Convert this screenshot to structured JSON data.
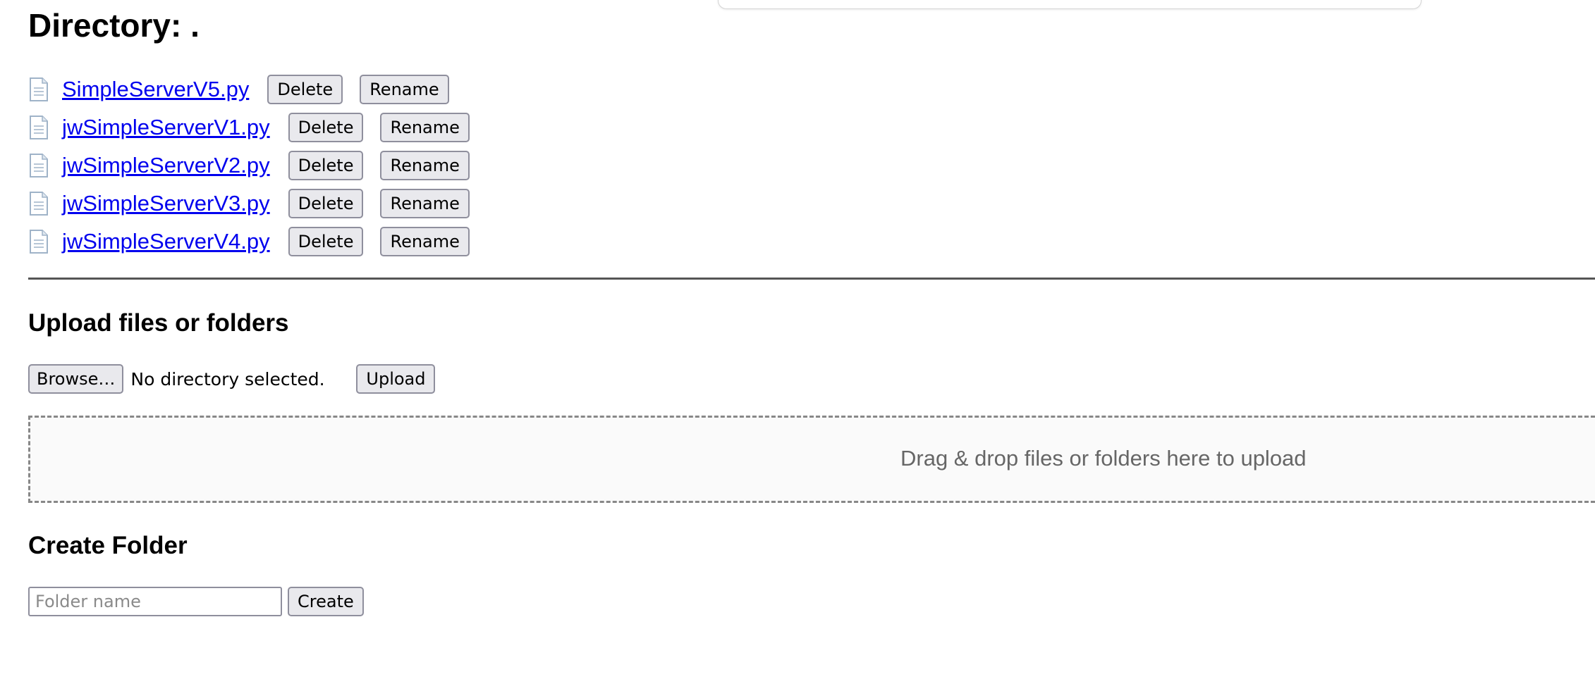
{
  "page": {
    "heading": "Directory: ."
  },
  "files": [
    {
      "name": "SimpleServerV5.py",
      "delete_label": "Delete",
      "rename_label": "Rename"
    },
    {
      "name": "jwSimpleServerV1.py",
      "delete_label": "Delete",
      "rename_label": "Rename"
    },
    {
      "name": "jwSimpleServerV2.py",
      "delete_label": "Delete",
      "rename_label": "Rename"
    },
    {
      "name": "jwSimpleServerV3.py",
      "delete_label": "Delete",
      "rename_label": "Rename"
    },
    {
      "name": "jwSimpleServerV4.py",
      "delete_label": "Delete",
      "rename_label": "Rename"
    }
  ],
  "upload": {
    "title": "Upload files or folders",
    "browse_label": "Browse…",
    "status": "No directory selected.",
    "upload_label": "Upload",
    "dropzone_text": "Drag & drop files or folders here to upload"
  },
  "create_folder": {
    "title": "Create Folder",
    "placeholder": "Folder name",
    "value": "",
    "create_label": "Create"
  },
  "icons": {
    "file": "file-icon"
  },
  "colors": {
    "link": "#0000ee",
    "button_bg": "#e9e9ed",
    "button_border": "#8f8f9d",
    "dropzone_border": "#888888",
    "dropzone_text": "#666666"
  }
}
